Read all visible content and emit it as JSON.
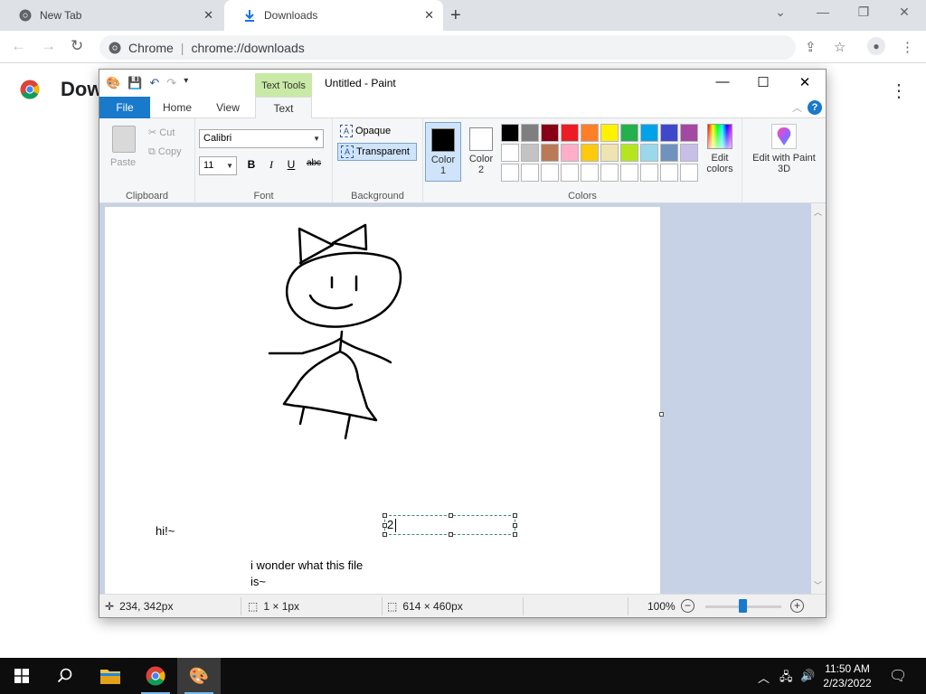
{
  "chrome": {
    "tabs": [
      {
        "title": "New Tab",
        "active": false
      },
      {
        "title": "Downloads",
        "active": true
      }
    ],
    "address": {
      "site_label": "Chrome",
      "url": "chrome://downloads"
    },
    "page_title": "Dow"
  },
  "paint": {
    "window_title": "Untitled - Paint",
    "context_tab": "Text Tools",
    "ribbon_tabs": [
      "File",
      "Home",
      "View",
      "Text"
    ],
    "clipboard": {
      "paste": "Paste",
      "cut": "Cut",
      "copy": "Copy",
      "label": "Clipboard"
    },
    "font": {
      "name": "Calibri",
      "size": "11",
      "label": "Font",
      "bold": "B",
      "italic": "I",
      "underline": "U",
      "strike": "abc"
    },
    "background": {
      "opaque": "Opaque",
      "transparent": "Transparent",
      "label": "Background",
      "selected": "transparent"
    },
    "colors": {
      "color1_label": "Color 1",
      "color2_label": "Color 2",
      "color1": "#000000",
      "color2": "#ffffff",
      "label": "Colors",
      "edit_colors": "Edit colors",
      "palette_row1": [
        "#000000",
        "#7f7f7f",
        "#880015",
        "#ed1c24",
        "#ff7f27",
        "#fff200",
        "#22b14c",
        "#00a2e8",
        "#3f48cc",
        "#a349a4"
      ],
      "palette_row2": [
        "#ffffff",
        "#c3c3c3",
        "#b97a57",
        "#ffaec9",
        "#ffc90e",
        "#efe4b0",
        "#b5e61d",
        "#99d9ea",
        "#7092be",
        "#c8bfe7"
      ],
      "palette_row3": [
        "#ffffff",
        "#ffffff",
        "#ffffff",
        "#ffffff",
        "#ffffff",
        "#ffffff",
        "#ffffff",
        "#ffffff",
        "#ffffff",
        "#ffffff"
      ]
    },
    "paint3d": "Edit with Paint 3D",
    "canvas_texts": {
      "hi": "hi!~",
      "wonder": "i wonder what this file",
      "wonder2": "is~",
      "typing": "2"
    },
    "status": {
      "cursor_pos": "234, 342px",
      "selection": "1 × 1px",
      "canvas_size": "614 × 460px",
      "zoom": "100%"
    }
  },
  "taskbar": {
    "time": "11:50 AM",
    "date": "2/23/2022"
  }
}
